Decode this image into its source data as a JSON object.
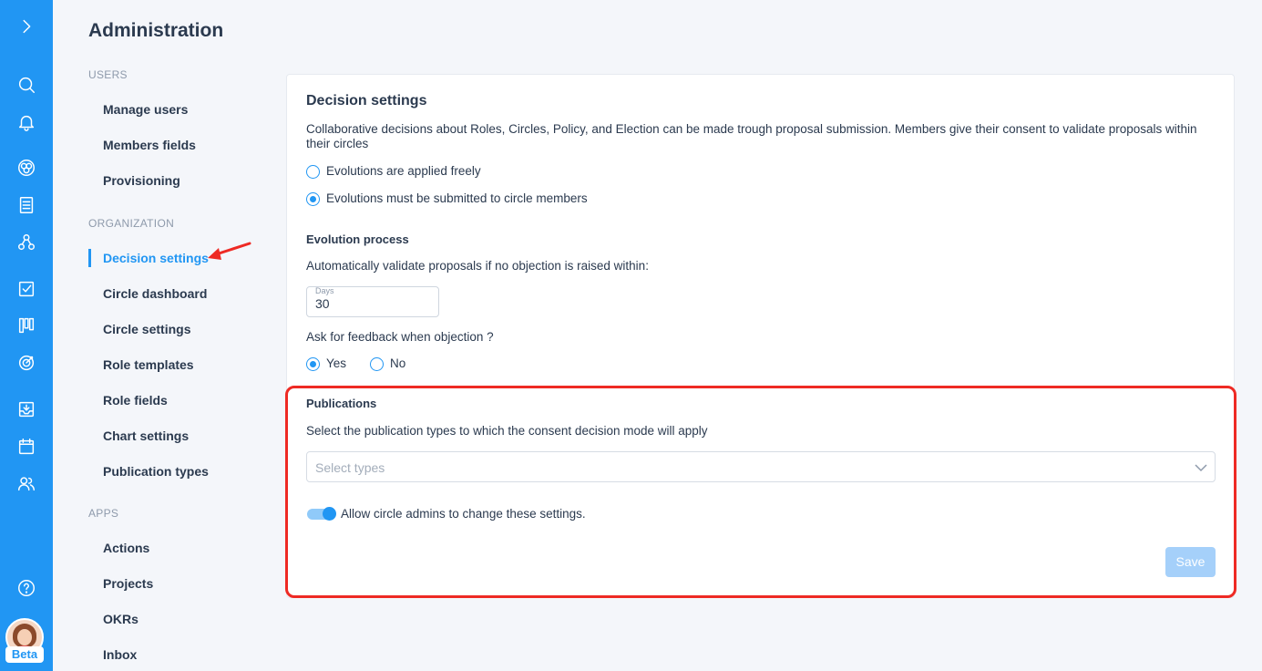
{
  "rail": {
    "icons": [
      "expand-icon",
      "search-icon",
      "bell-icon",
      "circles-icon",
      "document-icon",
      "people-tree-icon",
      "checkbox-icon",
      "kanban-icon",
      "target-icon",
      "inbox-icon",
      "calendar-icon",
      "users-icon",
      "help-icon"
    ],
    "badge": "Beta",
    "colors": {
      "rail": "#2196f3"
    }
  },
  "admin": {
    "title": "Administration",
    "sections": [
      {
        "label": "USERS",
        "items": [
          "Manage users",
          "Members fields",
          "Provisioning"
        ]
      },
      {
        "label": "ORGANIZATION",
        "items": [
          "Decision settings",
          "Circle dashboard",
          "Circle settings",
          "Role templates",
          "Role fields",
          "Chart settings",
          "Publication types"
        ]
      },
      {
        "label": "APPS",
        "items": [
          "Actions",
          "Projects",
          "OKRs",
          "Inbox"
        ]
      }
    ],
    "active": "Decision settings"
  },
  "decision": {
    "title": "Decision settings",
    "description": "Collaborative decisions about Roles, Circles, Policy, and Election can be made trough proposal submission. Members give their consent to validate proposals within their circles",
    "options": [
      {
        "label": "Evolutions are applied freely",
        "selected": false
      },
      {
        "label": "Evolutions must be submitted to circle members",
        "selected": true
      }
    ],
    "evolution": {
      "title": "Evolution process",
      "auto_label": "Automatically validate proposals if no objection is raised within:",
      "days_label": "Days",
      "days_value": "30",
      "feedback_label": "Ask for feedback when objection ?",
      "yes": "Yes",
      "no": "No",
      "feedback_selected": "Yes"
    },
    "publications": {
      "title": "Publications",
      "description": "Select the publication types to which the consent decision mode will apply",
      "placeholder": "Select types",
      "toggle_label": "Allow circle admins to change these settings.",
      "toggle_on": true
    },
    "save_label": "Save"
  },
  "annotation": {
    "highlight_color": "#ee2a24"
  }
}
